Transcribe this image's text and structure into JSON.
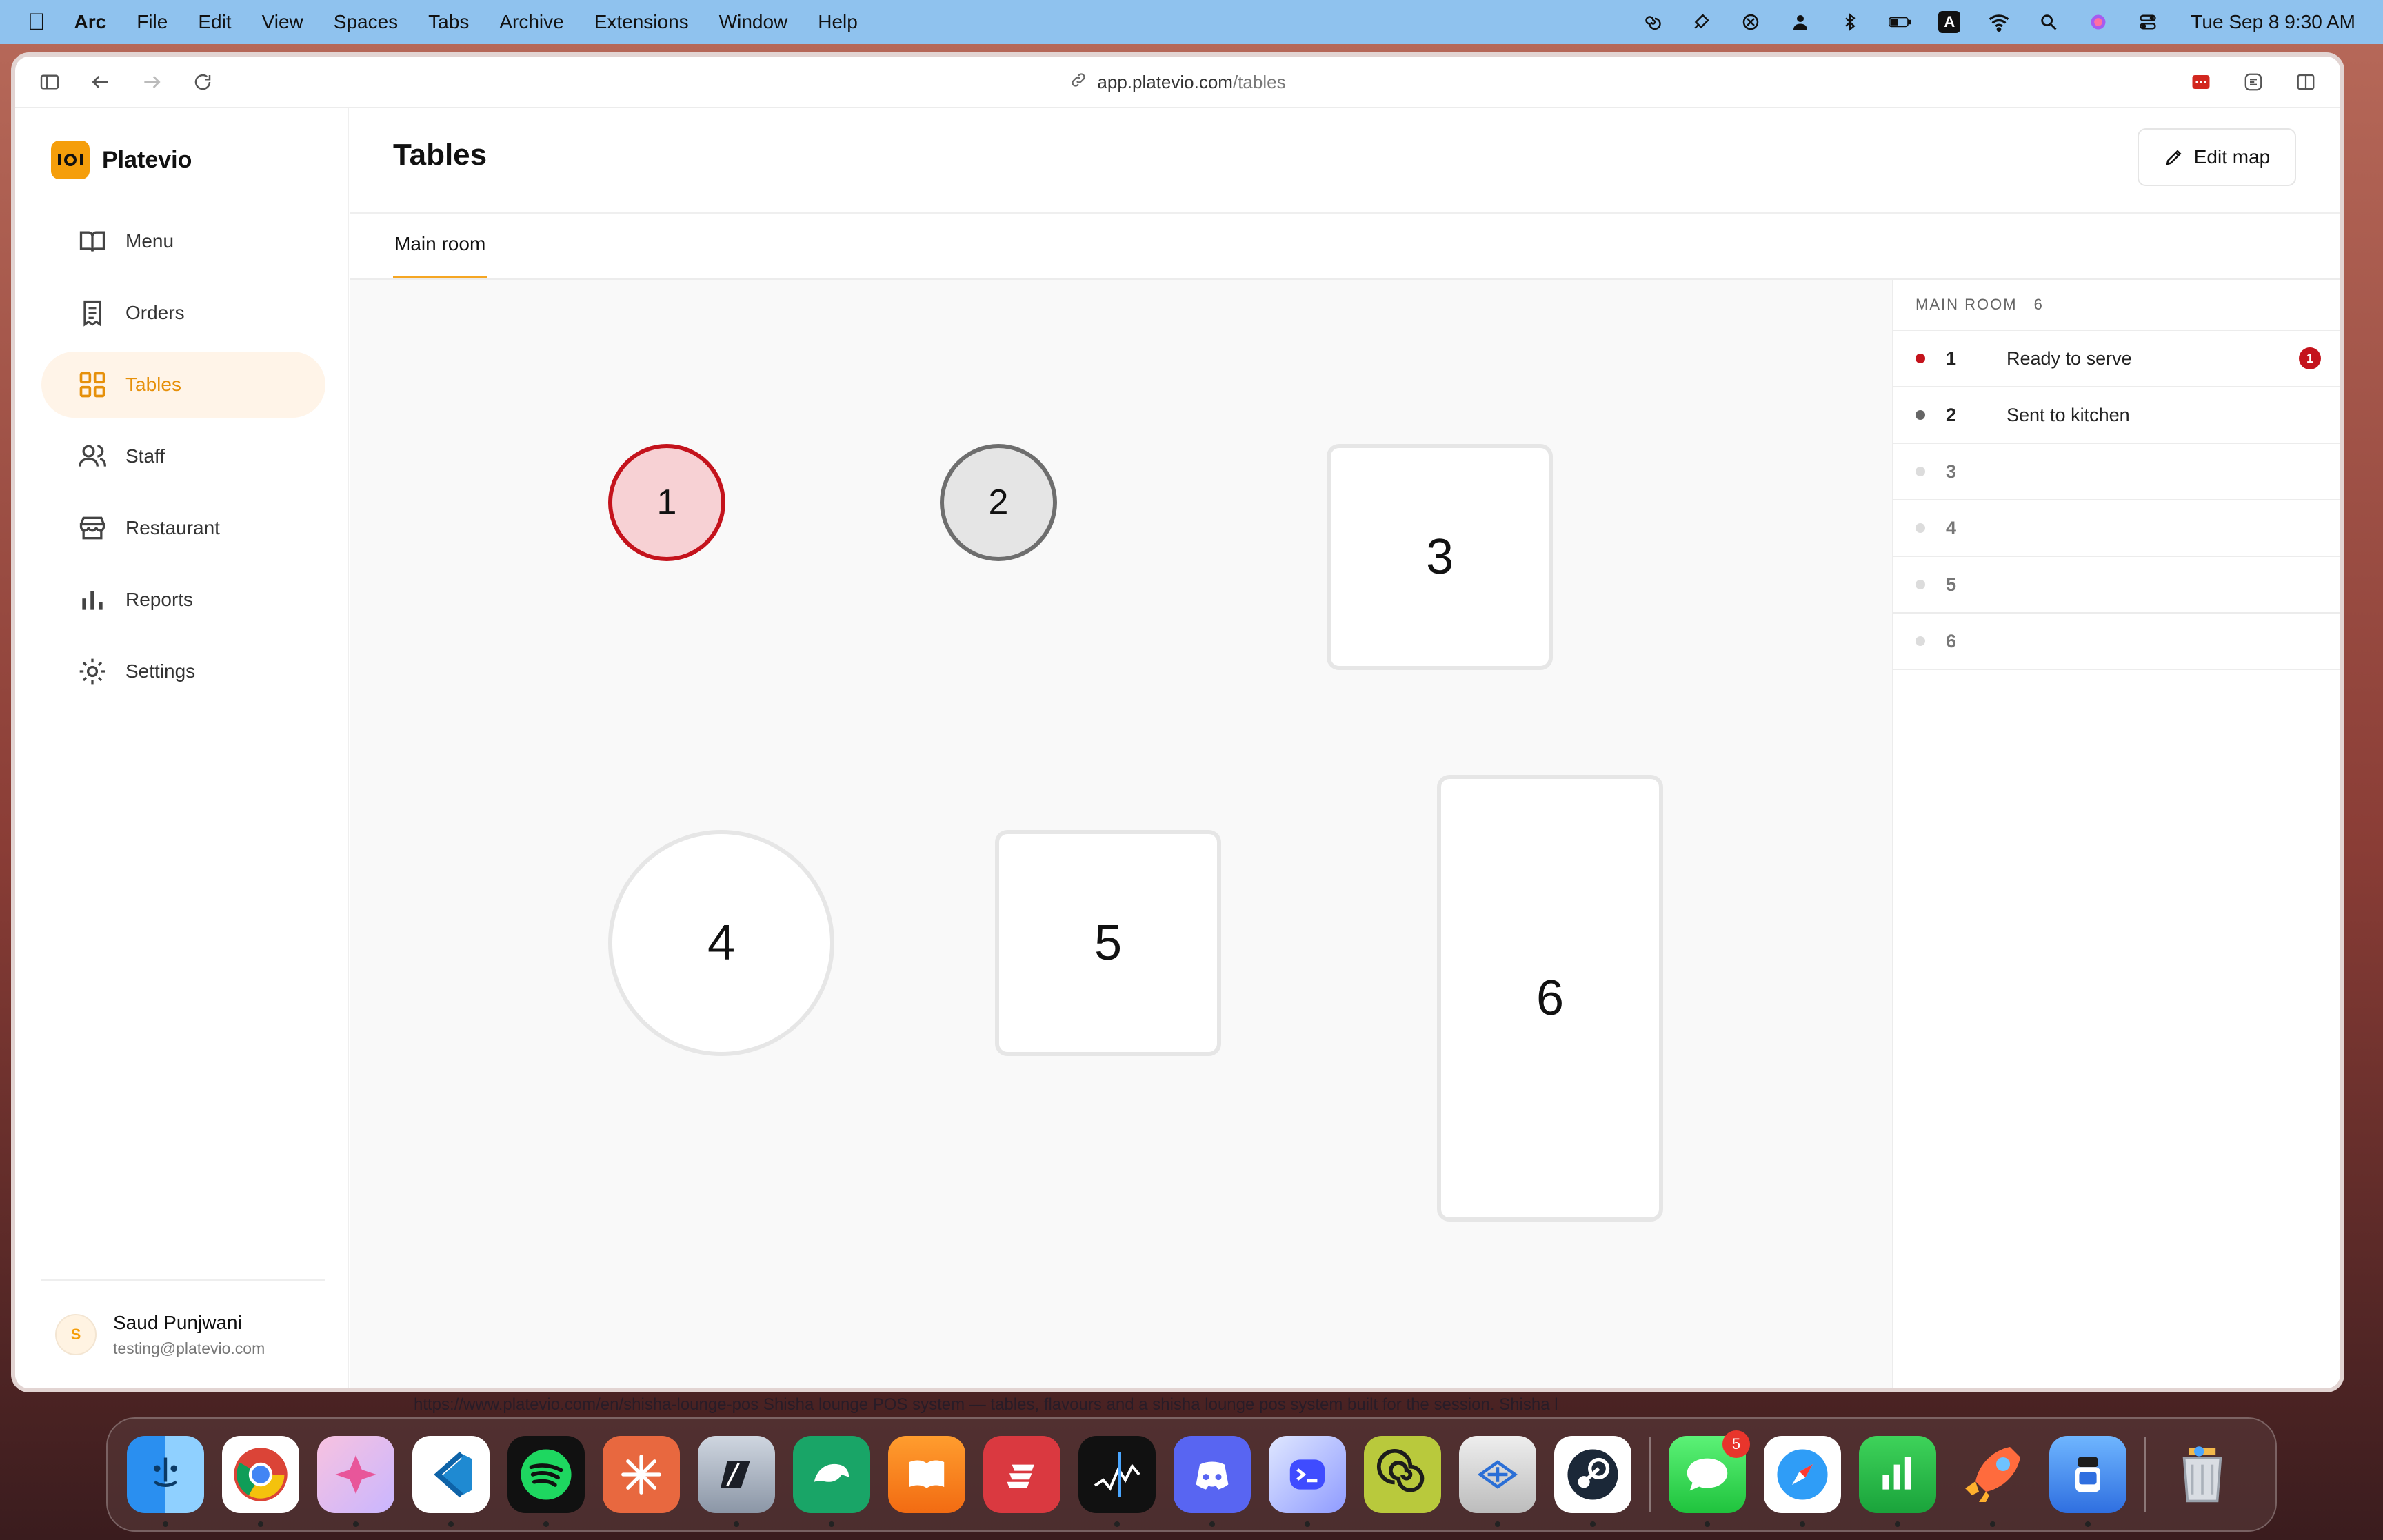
{
  "menubar": {
    "app": "Arc",
    "items": [
      "File",
      "Edit",
      "View",
      "Spaces",
      "Tabs",
      "Archive",
      "Extensions",
      "Window",
      "Help"
    ],
    "input_source": "A",
    "clock": "Tue Sep 8  9:30 AM"
  },
  "browser": {
    "url_host": "app.platevio.com",
    "url_path": "/tables"
  },
  "sidebar": {
    "brand": "Platevio",
    "brand_logo_text": "IOI",
    "nav": [
      {
        "label": "Menu",
        "icon": "book-icon"
      },
      {
        "label": "Orders",
        "icon": "receipt-icon"
      },
      {
        "label": "Tables",
        "icon": "grid-icon"
      },
      {
        "label": "Staff",
        "icon": "users-icon"
      },
      {
        "label": "Restaurant",
        "icon": "store-icon"
      },
      {
        "label": "Reports",
        "icon": "bar-chart-icon"
      },
      {
        "label": "Settings",
        "icon": "gear-icon"
      }
    ],
    "active_nav": "Tables",
    "user": {
      "initial": "S",
      "name": "Saud Punjwani",
      "email": "testing@platevio.com"
    }
  },
  "main": {
    "title": "Tables",
    "edit_map_label": "Edit map",
    "tabs": [
      {
        "label": "Main room",
        "active": true
      }
    ],
    "floor": {
      "tables": [
        {
          "number": "1",
          "shape": "round",
          "status": "ready"
        },
        {
          "number": "2",
          "shape": "round",
          "status": "kitchen"
        },
        {
          "number": "3",
          "shape": "square",
          "status": "idle"
        },
        {
          "number": "4",
          "shape": "round",
          "status": "idle"
        },
        {
          "number": "5",
          "shape": "square",
          "status": "idle"
        },
        {
          "number": "6",
          "shape": "square",
          "status": "idle"
        }
      ]
    },
    "list": {
      "header": "MAIN ROOM",
      "count": "6",
      "rows": [
        {
          "number": "1",
          "status_text": "Ready to serve",
          "badge": "1"
        },
        {
          "number": "2",
          "status_text": "Sent to kitchen"
        },
        {
          "number": "3",
          "status_text": ""
        },
        {
          "number": "4",
          "status_text": ""
        },
        {
          "number": "5",
          "status_text": ""
        },
        {
          "number": "6",
          "status_text": ""
        }
      ]
    }
  },
  "status_strip": "https://www.platevio.com/en/shisha-lounge-pos  Shisha lounge POS system — tables, flavours and a shisha lounge pos system built for the session.  Shisha l",
  "dock": {
    "apps": [
      "Finder",
      "Chrome",
      "Craft",
      "VS Code",
      "Spotify",
      "Claude",
      "Cursor",
      "DataGrip",
      "Books",
      "ExpressVPN",
      "Stocks",
      "Discord",
      "Warp",
      "Sonic",
      "RetroArch",
      "Steam",
      "Messages",
      "Safari",
      "Numbers",
      "Rocket",
      "Simulator",
      "Trash"
    ],
    "messages_badge": "5"
  },
  "colors": {
    "accent": "#f5a623",
    "ready": "#c4131c",
    "kitchen": "#6e6e6e"
  }
}
